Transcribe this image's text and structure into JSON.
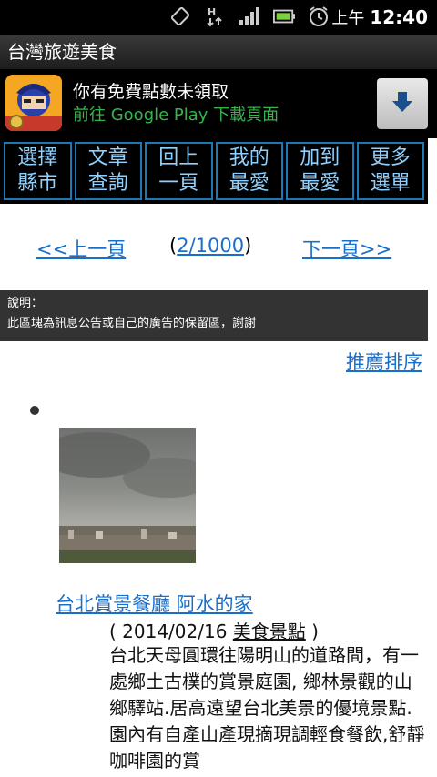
{
  "status_bar": {
    "icons": [
      "rotate-icon",
      "data-transfer-icon",
      "signal-icon",
      "battery-icon",
      "alarm-icon"
    ],
    "ampm": "上午",
    "time": "12:40"
  },
  "app": {
    "title": "台灣旅遊美食"
  },
  "ad": {
    "line1": "你有免費點數未領取",
    "line2": "前往 Google Play 下載頁面",
    "icon": "download-icon"
  },
  "nav": {
    "items": [
      {
        "label": "選擇\n縣市"
      },
      {
        "label": "文章\n查詢"
      },
      {
        "label": "回上\n一頁"
      },
      {
        "label": "我的\n最愛"
      },
      {
        "label": "加到\n最愛"
      },
      {
        "label": "更多\n選單"
      }
    ]
  },
  "pager": {
    "prev": "<<上一頁",
    "open": "(",
    "current": "2/1000",
    "close": ")",
    "next": "下一頁>>"
  },
  "notice": {
    "line1": "說明：",
    "line2": "此區塊為訊息公告或自己的廣告的保留區，謝謝"
  },
  "sort_link": "推薦排序",
  "article": {
    "title": "台北賞景餐廳 阿水的家",
    "date_open": "( 2014/02/16 ",
    "category": "美食景點",
    "date_close": " )",
    "description": "台北天母圓環往陽明山的道路間，有一處鄉土古樸的賞景庭園, 鄉林景觀的山鄉驛站.居高遠望台北美景的優境景點. 園內有自產山產現摘現調輕食餐飲,舒靜咖啡園的賞"
  },
  "colors": {
    "link": "#1a6fc9",
    "nav_border": "#1e78b4",
    "nav_text": "#8fd0ff",
    "ad_green": "#35b54b",
    "notice_bg": "#333333"
  }
}
